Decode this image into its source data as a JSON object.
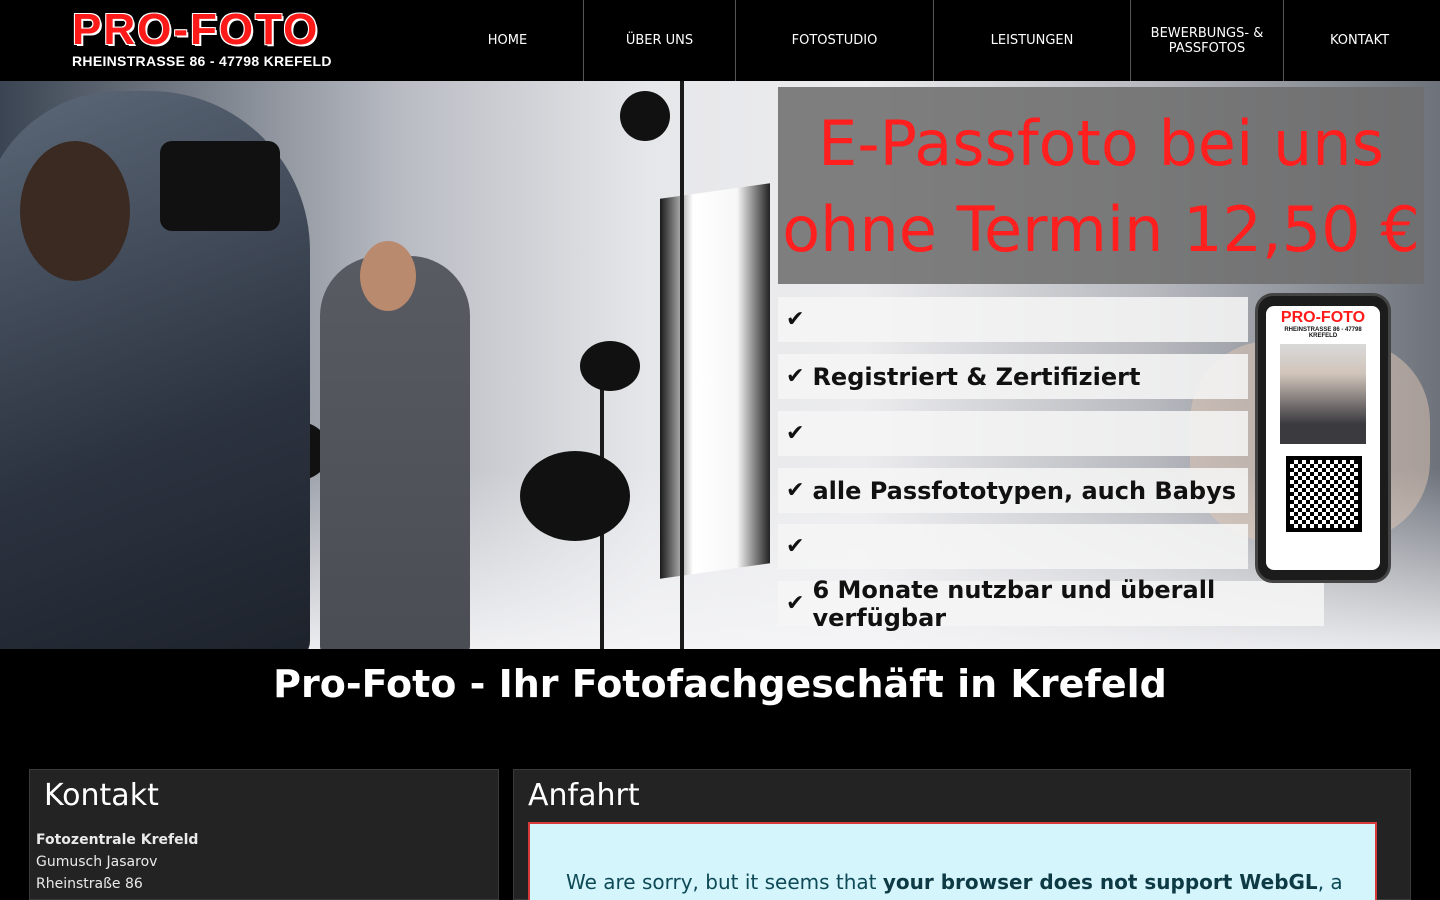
{
  "header": {
    "logo_title": "PRO-FOTO",
    "logo_subtitle": "RHEINSTRASSE 86 - 47798 KREFELD",
    "nav": [
      {
        "label": "HOME"
      },
      {
        "label": "ÜBER UNS"
      },
      {
        "label": "FOTOSTUDIO"
      },
      {
        "label": "LEISTUNGEN"
      },
      {
        "label": "BEWERBUNGS- & PASSFOTOS"
      },
      {
        "label": "KONTAKT"
      }
    ]
  },
  "hero": {
    "promo_line_1": "E-Passfoto bei uns",
    "promo_line_2": "ohne Termin 12,50 €",
    "features": [
      {
        "icon": "check-icon",
        "text": ""
      },
      {
        "icon": "check-icon",
        "text": "Registriert & Zertifiziert"
      },
      {
        "icon": "check-icon",
        "text": ""
      },
      {
        "icon": "check-icon",
        "text": "alle Passfototypen, auch Babys"
      },
      {
        "icon": "check-icon",
        "text": ""
      },
      {
        "icon": "check-icon",
        "text": "6 Monate nutzbar und überall verfügbar"
      }
    ],
    "phone_logo": "PRO-FOTO",
    "phone_logo_sub": "RHEINSTRASSE 86 - 47798 KREFELD"
  },
  "main": {
    "title": "Pro-Foto - Ihr Fotofachgeschäft in Krefeld",
    "contact": {
      "heading": "Kontakt",
      "company": "Fotozentrale Krefeld",
      "name": "Gumusch Jasarov",
      "street": "Rheinstraße 86"
    },
    "directions": {
      "heading": "Anfahrt",
      "webgl_prefix": "We are sorry, but it seems that ",
      "webgl_bold": "your browser does not support WebGL",
      "webgl_suffix": ", a"
    }
  },
  "colors": {
    "brand_red": "#ff1a1a",
    "background": "#000000",
    "panel": "#232323",
    "notice_bg": "#d5f5fd",
    "notice_border": "#d63a3a"
  }
}
